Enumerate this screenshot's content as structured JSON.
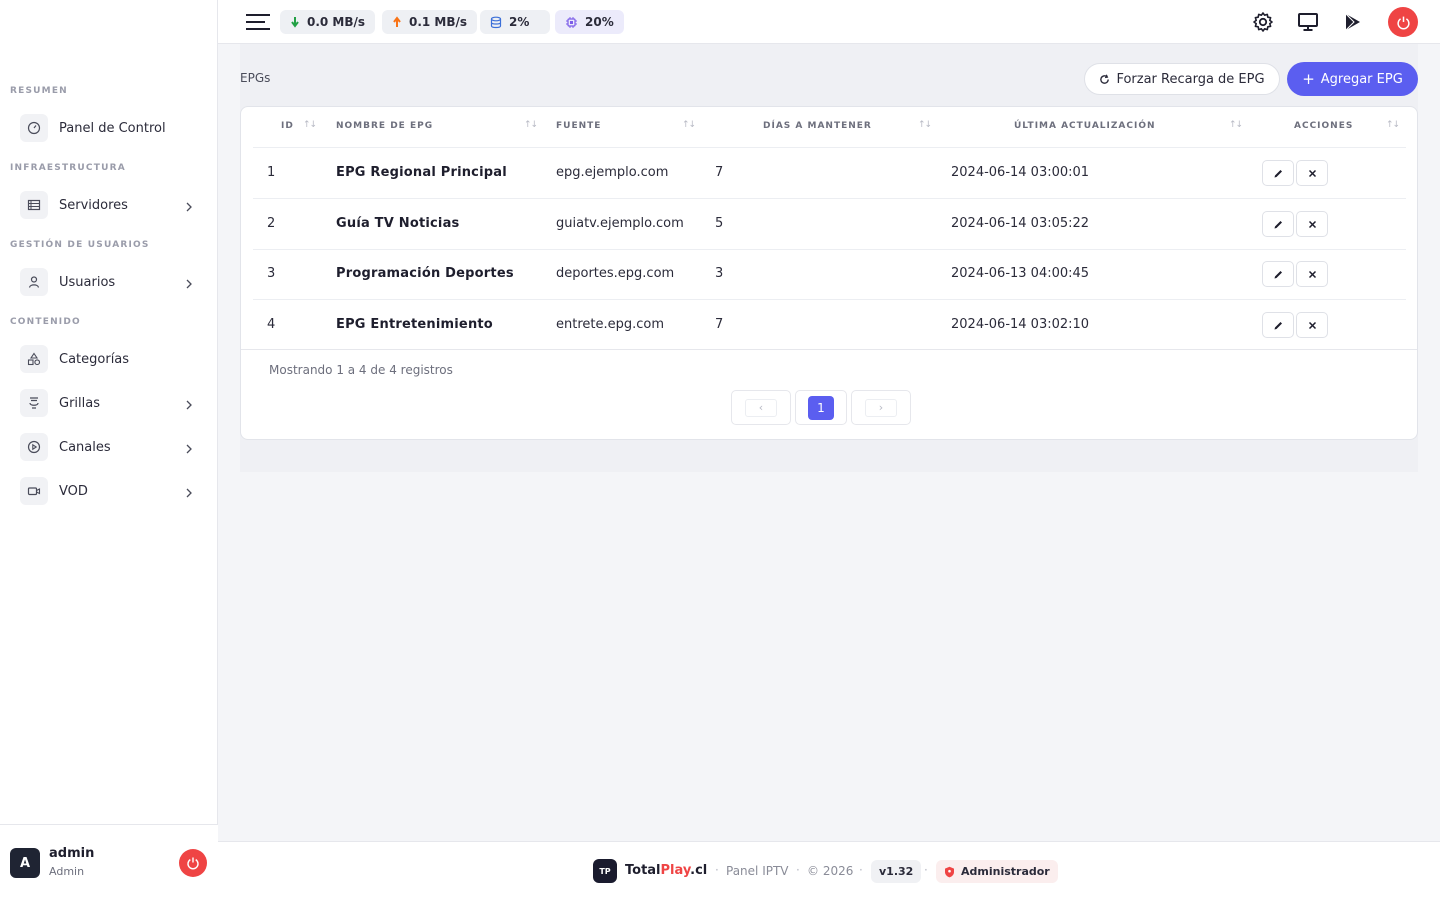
{
  "sidebar": {
    "sections": {
      "resumen": "RESUMEN",
      "infraestructura": "INFRAESTRUCTURA",
      "gestion": "GESTIÓN DE USUARIOS",
      "contenido": "CONTENIDO"
    },
    "items": [
      {
        "label": "Panel de Control",
        "icon": "dashboard-icon"
      },
      {
        "label": "Servidores",
        "icon": "server-icon"
      },
      {
        "label": "Usuarios",
        "icon": "user-icon"
      },
      {
        "label": "Categorías",
        "icon": "shapes-icon"
      },
      {
        "label": "Grillas",
        "icon": "grid-icon"
      },
      {
        "label": "Canales",
        "icon": "play-circle-icon"
      },
      {
        "label": "VOD",
        "icon": "video-icon"
      }
    ],
    "user": {
      "initial": "A",
      "name": "admin",
      "role": "Admin"
    }
  },
  "topbar": {
    "download": "0.0 MB/s",
    "upload": "0.1 MB/s",
    "disk": "2%",
    "cpu": "20%"
  },
  "page": {
    "title": "EPGs",
    "reload_button": "Forzar Recarga de EPG",
    "add_button": "Agregar EPG",
    "add_plus": "+"
  },
  "table": {
    "columns": {
      "id": "ID",
      "name": "NOMBRE DE EPG",
      "source": "FUENTE",
      "days": "DÍAS A MANTENER",
      "updated": "ÚLTIMA ACTUALIZACIÓN",
      "actions": "ACCIONES"
    },
    "rows": [
      {
        "id": "1",
        "name": "EPG Regional Principal",
        "source": "epg.ejemplo.com",
        "days": "7",
        "updated": "2024-06-14 03:00:01"
      },
      {
        "id": "2",
        "name": "Guía TV Noticias",
        "source": "guiatv.ejemplo.com",
        "days": "5",
        "updated": "2024-06-14 03:05:22"
      },
      {
        "id": "3",
        "name": "Programación Deportes",
        "source": "deportes.epg.com",
        "days": "3",
        "updated": "2024-06-13 04:00:45"
      },
      {
        "id": "4",
        "name": "EPG Entretenimiento",
        "source": "entrete.epg.com",
        "days": "7",
        "updated": "2024-06-14 03:02:10"
      }
    ],
    "showing": "Mostrando 1 a 4 de 4 registros",
    "pagination": {
      "prev": "‹",
      "current": "1",
      "next": "›"
    }
  },
  "footer": {
    "logo": "TP",
    "brand_main": "Total",
    "brand_accent": "Play",
    "brand_suffix": ".cl",
    "panel": "Panel IPTV",
    "year": "© 2026",
    "version": "v1.32",
    "role": "Administrador",
    "separator": "·"
  },
  "colors": {
    "accent": "#5b5ef0",
    "danger": "#ef4444",
    "download": "#22a045",
    "upload": "#f97316"
  }
}
